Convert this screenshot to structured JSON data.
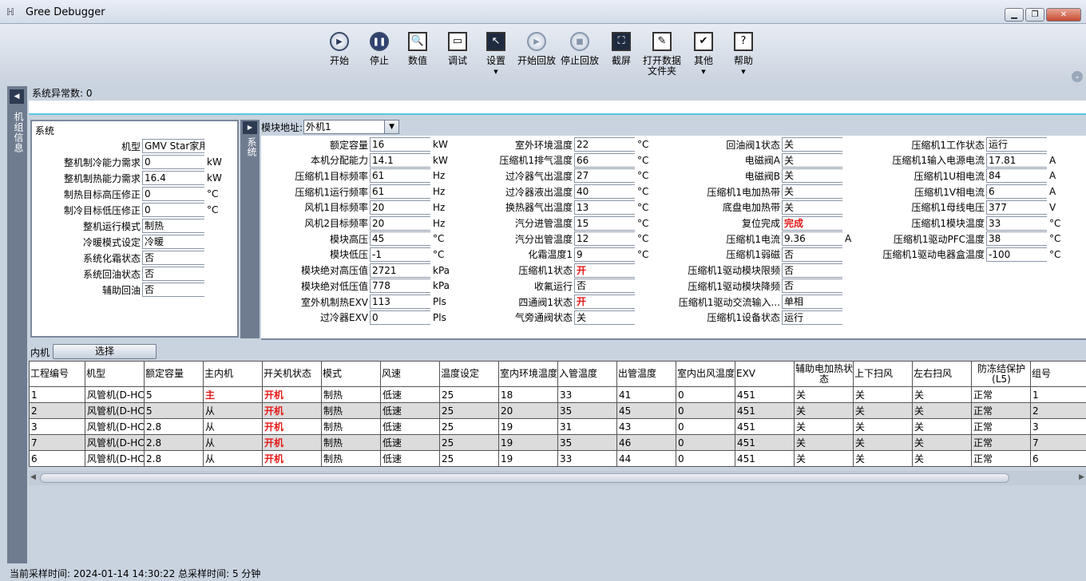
{
  "window": {
    "title": "Gree Debugger",
    "min": "▁",
    "restore": "❐",
    "close": "✕"
  },
  "toolbar": [
    {
      "name": "start",
      "label": "开始",
      "icon": "play-icon"
    },
    {
      "name": "stop",
      "label": "停止",
      "icon": "pause-icon"
    },
    {
      "name": "values",
      "label": "数值",
      "icon": "search-doc-icon"
    },
    {
      "name": "debug",
      "label": "调试",
      "icon": "monitor-icon"
    },
    {
      "name": "settings",
      "label": "设置",
      "icon": "cursor-icon"
    },
    {
      "name": "start-replay",
      "label": "开始回放",
      "icon": "replay-play-icon"
    },
    {
      "name": "stop-replay",
      "label": "停止回放",
      "icon": "replay-stop-icon"
    },
    {
      "name": "screenshot",
      "label": "截屏",
      "icon": "screenshot-icon"
    },
    {
      "name": "open-data-folder",
      "label": "打开数据\n文件夹",
      "icon": "folder-icon"
    },
    {
      "name": "other",
      "label": "其他",
      "icon": "check-folder-icon"
    },
    {
      "name": "help",
      "label": "帮助",
      "icon": "help-icon"
    }
  ],
  "left_strip": {
    "vertical_text": "机组信息"
  },
  "alarm": {
    "text": "系统异常数: 0"
  },
  "system": {
    "caption": "系统",
    "fields": [
      {
        "label": "机型",
        "value": "GMV Star家用",
        "unit": ""
      },
      {
        "label": "整机制冷能力需求",
        "value": "0",
        "unit": "kW"
      },
      {
        "label": "整机制热能力需求",
        "value": "16.4",
        "unit": "kW"
      },
      {
        "label": "制热目标高压修正",
        "value": "0",
        "unit": "°C"
      },
      {
        "label": "制冷目标低压修正",
        "value": "0",
        "unit": "°C"
      },
      {
        "label": "整机运行模式",
        "value": "制热",
        "unit": ""
      },
      {
        "label": "冷暖模式设定",
        "value": "冷暖",
        "unit": ""
      },
      {
        "label": "系统化霜状态",
        "value": "否",
        "unit": ""
      },
      {
        "label": "系统回油状态",
        "value": "否",
        "unit": ""
      },
      {
        "label": "辅助回油",
        "value": "否",
        "unit": ""
      }
    ]
  },
  "module": {
    "strip_text": "系统",
    "address_label": "模块地址:",
    "address_value": "外机1",
    "columns": [
      [
        {
          "label": "额定容量",
          "value": "16",
          "unit": "kW"
        },
        {
          "label": "本机分配能力",
          "value": "14.1",
          "unit": "kW"
        },
        {
          "label": "压缩机1目标频率",
          "value": "61",
          "unit": "Hz"
        },
        {
          "label": "压缩机1运行频率",
          "value": "61",
          "unit": "Hz"
        },
        {
          "label": "风机1目标频率",
          "value": "20",
          "unit": "Hz"
        },
        {
          "label": "风机2目标频率",
          "value": "20",
          "unit": "Hz"
        },
        {
          "label": "模块高压",
          "value": "45",
          "unit": "°C"
        },
        {
          "label": "模块低压",
          "value": "-1",
          "unit": "°C"
        },
        {
          "label": "模块绝对高压值",
          "value": "2721",
          "unit": "kPa"
        },
        {
          "label": "模块绝对低压值",
          "value": "778",
          "unit": "kPa"
        },
        {
          "label": "室外机制热EXV",
          "value": "113",
          "unit": "Pls"
        },
        {
          "label": "过冷器EXV",
          "value": "0",
          "unit": "Pls"
        }
      ],
      [
        {
          "label": "室外环境温度",
          "value": "22",
          "unit": "°C"
        },
        {
          "label": "压缩机1排气温度",
          "value": "66",
          "unit": "°C"
        },
        {
          "label": "过冷器气出温度",
          "value": "27",
          "unit": "°C"
        },
        {
          "label": "过冷器液出温度",
          "value": "40",
          "unit": "°C"
        },
        {
          "label": "换热器气出温度",
          "value": "13",
          "unit": "°C"
        },
        {
          "label": "汽分进管温度",
          "value": "15",
          "unit": "°C"
        },
        {
          "label": "汽分出管温度",
          "value": "12",
          "unit": "°C"
        },
        {
          "label": "化霜温度1",
          "value": "9",
          "unit": "°C"
        },
        {
          "label": "压缩机1状态",
          "value": "开",
          "unit": "",
          "red": true
        },
        {
          "label": "收氟运行",
          "value": "否",
          "unit": ""
        },
        {
          "label": "四通阀1状态",
          "value": "开",
          "unit": "",
          "red": true
        },
        {
          "label": "气旁通阀状态",
          "value": "关",
          "unit": ""
        }
      ],
      [
        {
          "label": "回油阀1状态",
          "value": "关",
          "unit": ""
        },
        {
          "label": "电磁阀A",
          "value": "关",
          "unit": ""
        },
        {
          "label": "电磁阀B",
          "value": "关",
          "unit": ""
        },
        {
          "label": "压缩机1电加热带",
          "value": "关",
          "unit": ""
        },
        {
          "label": "底盘电加热带",
          "value": "关",
          "unit": ""
        },
        {
          "label": "复位完成",
          "value": "完成",
          "unit": "",
          "red": true
        },
        {
          "label": "压缩机1电流",
          "value": "9.36",
          "unit": "A"
        },
        {
          "label": "压缩机1弱磁",
          "value": "否",
          "unit": ""
        },
        {
          "label": "压缩机1驱动模块限频",
          "value": "否",
          "unit": ""
        },
        {
          "label": "压缩机1驱动模块降频",
          "value": "否",
          "unit": ""
        },
        {
          "label": "压缩机1驱动交流输入...",
          "value": "单相",
          "unit": ""
        },
        {
          "label": "压缩机1设备状态",
          "value": "运行",
          "unit": ""
        }
      ],
      [
        {
          "label": "压缩机1工作状态",
          "value": "运行",
          "unit": ""
        },
        {
          "label": "压缩机1输入电源电流",
          "value": "17.81",
          "unit": "A"
        },
        {
          "label": "压缩机1U相电流",
          "value": "84",
          "unit": "A"
        },
        {
          "label": "压缩机1V相电流",
          "value": "6",
          "unit": "A"
        },
        {
          "label": "压缩机1母线电压",
          "value": "377",
          "unit": "V"
        },
        {
          "label": "压缩机1模块温度",
          "value": "33",
          "unit": "°C"
        },
        {
          "label": "压缩机1驱动PFC温度",
          "value": "38",
          "unit": "°C"
        },
        {
          "label": "压缩机1驱动电器盒温度",
          "value": "-100",
          "unit": "°C"
        }
      ]
    ]
  },
  "indoor": {
    "label": "内机",
    "select_button": "选择",
    "headers": [
      "工程编号",
      "机型",
      "额定容量",
      "主内机",
      "开关机状态",
      "模式",
      "风速",
      "温度设定",
      "室内环境温度",
      "入管温度",
      "出管温度",
      "室内出风温度",
      "EXV",
      "辅助电加热状态",
      "上下扫风",
      "左右扫风",
      "防冻结保护(L5)",
      "组号"
    ],
    "rows": [
      [
        "1",
        "风管机(D-HC",
        "5",
        "主",
        "开机",
        "制热",
        "低速",
        "25",
        "18",
        "33",
        "41",
        "0",
        "451",
        "关",
        "关",
        "关",
        "正常",
        "1"
      ],
      [
        "2",
        "风管机(D-HC",
        "5",
        "从",
        "开机",
        "制热",
        "低速",
        "25",
        "20",
        "35",
        "45",
        "0",
        "451",
        "关",
        "关",
        "关",
        "正常",
        "2"
      ],
      [
        "3",
        "风管机(D-HC",
        "2.8",
        "从",
        "开机",
        "制热",
        "低速",
        "25",
        "19",
        "31",
        "43",
        "0",
        "451",
        "关",
        "关",
        "关",
        "正常",
        "3"
      ],
      [
        "7",
        "风管机(D-HC",
        "2.8",
        "从",
        "开机",
        "制热",
        "低速",
        "25",
        "19",
        "35",
        "46",
        "0",
        "451",
        "关",
        "关",
        "关",
        "正常",
        "7"
      ],
      [
        "6",
        "风管机(D-HC",
        "2.8",
        "从",
        "开机",
        "制热",
        "低速",
        "25",
        "19",
        "33",
        "44",
        "0",
        "451",
        "关",
        "关",
        "关",
        "正常",
        "6"
      ]
    ]
  },
  "status": {
    "text": "当前采样时间: 2024-01-14 14:30:22  总采样时间: 5 分钟"
  }
}
